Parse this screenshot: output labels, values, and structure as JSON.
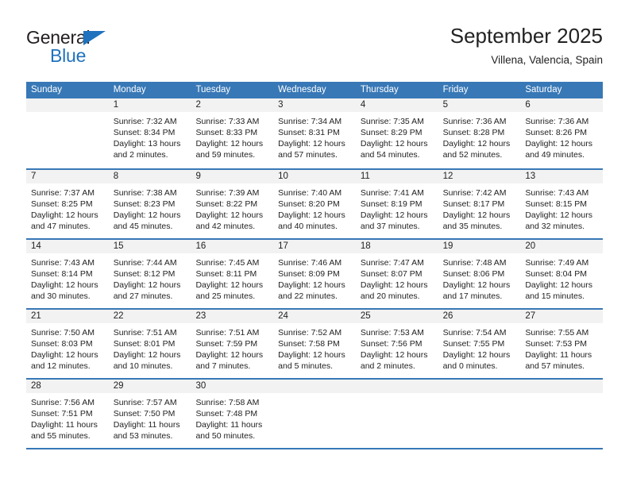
{
  "brand": {
    "name_top": "General",
    "name_bottom": "Blue",
    "accent_color": "#1f72bd"
  },
  "header": {
    "title": "September 2025",
    "location": "Villena, Valencia, Spain"
  },
  "calendar": {
    "header_color": "#3878b6",
    "day_number_band_color": "#f2f2f2",
    "weekdays": [
      "Sunday",
      "Monday",
      "Tuesday",
      "Wednesday",
      "Thursday",
      "Friday",
      "Saturday"
    ],
    "weeks": [
      [
        {
          "day": "",
          "sunrise": "",
          "sunset": "",
          "daylight_line1": "",
          "daylight_line2": ""
        },
        {
          "day": "1",
          "sunrise": "Sunrise: 7:32 AM",
          "sunset": "Sunset: 8:34 PM",
          "daylight_line1": "Daylight: 13 hours",
          "daylight_line2": "and 2 minutes."
        },
        {
          "day": "2",
          "sunrise": "Sunrise: 7:33 AM",
          "sunset": "Sunset: 8:33 PM",
          "daylight_line1": "Daylight: 12 hours",
          "daylight_line2": "and 59 minutes."
        },
        {
          "day": "3",
          "sunrise": "Sunrise: 7:34 AM",
          "sunset": "Sunset: 8:31 PM",
          "daylight_line1": "Daylight: 12 hours",
          "daylight_line2": "and 57 minutes."
        },
        {
          "day": "4",
          "sunrise": "Sunrise: 7:35 AM",
          "sunset": "Sunset: 8:29 PM",
          "daylight_line1": "Daylight: 12 hours",
          "daylight_line2": "and 54 minutes."
        },
        {
          "day": "5",
          "sunrise": "Sunrise: 7:36 AM",
          "sunset": "Sunset: 8:28 PM",
          "daylight_line1": "Daylight: 12 hours",
          "daylight_line2": "and 52 minutes."
        },
        {
          "day": "6",
          "sunrise": "Sunrise: 7:36 AM",
          "sunset": "Sunset: 8:26 PM",
          "daylight_line1": "Daylight: 12 hours",
          "daylight_line2": "and 49 minutes."
        }
      ],
      [
        {
          "day": "7",
          "sunrise": "Sunrise: 7:37 AM",
          "sunset": "Sunset: 8:25 PM",
          "daylight_line1": "Daylight: 12 hours",
          "daylight_line2": "and 47 minutes."
        },
        {
          "day": "8",
          "sunrise": "Sunrise: 7:38 AM",
          "sunset": "Sunset: 8:23 PM",
          "daylight_line1": "Daylight: 12 hours",
          "daylight_line2": "and 45 minutes."
        },
        {
          "day": "9",
          "sunrise": "Sunrise: 7:39 AM",
          "sunset": "Sunset: 8:22 PM",
          "daylight_line1": "Daylight: 12 hours",
          "daylight_line2": "and 42 minutes."
        },
        {
          "day": "10",
          "sunrise": "Sunrise: 7:40 AM",
          "sunset": "Sunset: 8:20 PM",
          "daylight_line1": "Daylight: 12 hours",
          "daylight_line2": "and 40 minutes."
        },
        {
          "day": "11",
          "sunrise": "Sunrise: 7:41 AM",
          "sunset": "Sunset: 8:19 PM",
          "daylight_line1": "Daylight: 12 hours",
          "daylight_line2": "and 37 minutes."
        },
        {
          "day": "12",
          "sunrise": "Sunrise: 7:42 AM",
          "sunset": "Sunset: 8:17 PM",
          "daylight_line1": "Daylight: 12 hours",
          "daylight_line2": "and 35 minutes."
        },
        {
          "day": "13",
          "sunrise": "Sunrise: 7:43 AM",
          "sunset": "Sunset: 8:15 PM",
          "daylight_line1": "Daylight: 12 hours",
          "daylight_line2": "and 32 minutes."
        }
      ],
      [
        {
          "day": "14",
          "sunrise": "Sunrise: 7:43 AM",
          "sunset": "Sunset: 8:14 PM",
          "daylight_line1": "Daylight: 12 hours",
          "daylight_line2": "and 30 minutes."
        },
        {
          "day": "15",
          "sunrise": "Sunrise: 7:44 AM",
          "sunset": "Sunset: 8:12 PM",
          "daylight_line1": "Daylight: 12 hours",
          "daylight_line2": "and 27 minutes."
        },
        {
          "day": "16",
          "sunrise": "Sunrise: 7:45 AM",
          "sunset": "Sunset: 8:11 PM",
          "daylight_line1": "Daylight: 12 hours",
          "daylight_line2": "and 25 minutes."
        },
        {
          "day": "17",
          "sunrise": "Sunrise: 7:46 AM",
          "sunset": "Sunset: 8:09 PM",
          "daylight_line1": "Daylight: 12 hours",
          "daylight_line2": "and 22 minutes."
        },
        {
          "day": "18",
          "sunrise": "Sunrise: 7:47 AM",
          "sunset": "Sunset: 8:07 PM",
          "daylight_line1": "Daylight: 12 hours",
          "daylight_line2": "and 20 minutes."
        },
        {
          "day": "19",
          "sunrise": "Sunrise: 7:48 AM",
          "sunset": "Sunset: 8:06 PM",
          "daylight_line1": "Daylight: 12 hours",
          "daylight_line2": "and 17 minutes."
        },
        {
          "day": "20",
          "sunrise": "Sunrise: 7:49 AM",
          "sunset": "Sunset: 8:04 PM",
          "daylight_line1": "Daylight: 12 hours",
          "daylight_line2": "and 15 minutes."
        }
      ],
      [
        {
          "day": "21",
          "sunrise": "Sunrise: 7:50 AM",
          "sunset": "Sunset: 8:03 PM",
          "daylight_line1": "Daylight: 12 hours",
          "daylight_line2": "and 12 minutes."
        },
        {
          "day": "22",
          "sunrise": "Sunrise: 7:51 AM",
          "sunset": "Sunset: 8:01 PM",
          "daylight_line1": "Daylight: 12 hours",
          "daylight_line2": "and 10 minutes."
        },
        {
          "day": "23",
          "sunrise": "Sunrise: 7:51 AM",
          "sunset": "Sunset: 7:59 PM",
          "daylight_line1": "Daylight: 12 hours",
          "daylight_line2": "and 7 minutes."
        },
        {
          "day": "24",
          "sunrise": "Sunrise: 7:52 AM",
          "sunset": "Sunset: 7:58 PM",
          "daylight_line1": "Daylight: 12 hours",
          "daylight_line2": "and 5 minutes."
        },
        {
          "day": "25",
          "sunrise": "Sunrise: 7:53 AM",
          "sunset": "Sunset: 7:56 PM",
          "daylight_line1": "Daylight: 12 hours",
          "daylight_line2": "and 2 minutes."
        },
        {
          "day": "26",
          "sunrise": "Sunrise: 7:54 AM",
          "sunset": "Sunset: 7:55 PM",
          "daylight_line1": "Daylight: 12 hours",
          "daylight_line2": "and 0 minutes."
        },
        {
          "day": "27",
          "sunrise": "Sunrise: 7:55 AM",
          "sunset": "Sunset: 7:53 PM",
          "daylight_line1": "Daylight: 11 hours",
          "daylight_line2": "and 57 minutes."
        }
      ],
      [
        {
          "day": "28",
          "sunrise": "Sunrise: 7:56 AM",
          "sunset": "Sunset: 7:51 PM",
          "daylight_line1": "Daylight: 11 hours",
          "daylight_line2": "and 55 minutes."
        },
        {
          "day": "29",
          "sunrise": "Sunrise: 7:57 AM",
          "sunset": "Sunset: 7:50 PM",
          "daylight_line1": "Daylight: 11 hours",
          "daylight_line2": "and 53 minutes."
        },
        {
          "day": "30",
          "sunrise": "Sunrise: 7:58 AM",
          "sunset": "Sunset: 7:48 PM",
          "daylight_line1": "Daylight: 11 hours",
          "daylight_line2": "and 50 minutes."
        },
        {
          "day": "",
          "sunrise": "",
          "sunset": "",
          "daylight_line1": "",
          "daylight_line2": ""
        },
        {
          "day": "",
          "sunrise": "",
          "sunset": "",
          "daylight_line1": "",
          "daylight_line2": ""
        },
        {
          "day": "",
          "sunrise": "",
          "sunset": "",
          "daylight_line1": "",
          "daylight_line2": ""
        },
        {
          "day": "",
          "sunrise": "",
          "sunset": "",
          "daylight_line1": "",
          "daylight_line2": ""
        }
      ]
    ]
  }
}
